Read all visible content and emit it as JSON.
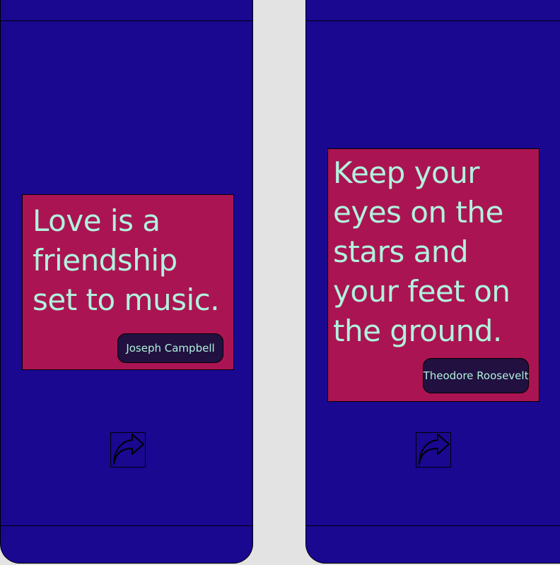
{
  "colors": {
    "screen_bg": "#1a0891",
    "card_bg": "#ab1452",
    "quote_text": "#b0f2dd",
    "author_bg": "#211040",
    "gutter": "#e3e3e3"
  },
  "screens": [
    {
      "quote": "Love is a\nfriendship\nset to music.",
      "author": "Joseph Campbell",
      "share_icon": "share-arrow-icon"
    },
    {
      "quote": "Keep your\neyes on the\nstars and\nyour feet on\nthe ground.",
      "author": "Theodore Roosevelt",
      "share_icon": "share-arrow-icon"
    }
  ]
}
